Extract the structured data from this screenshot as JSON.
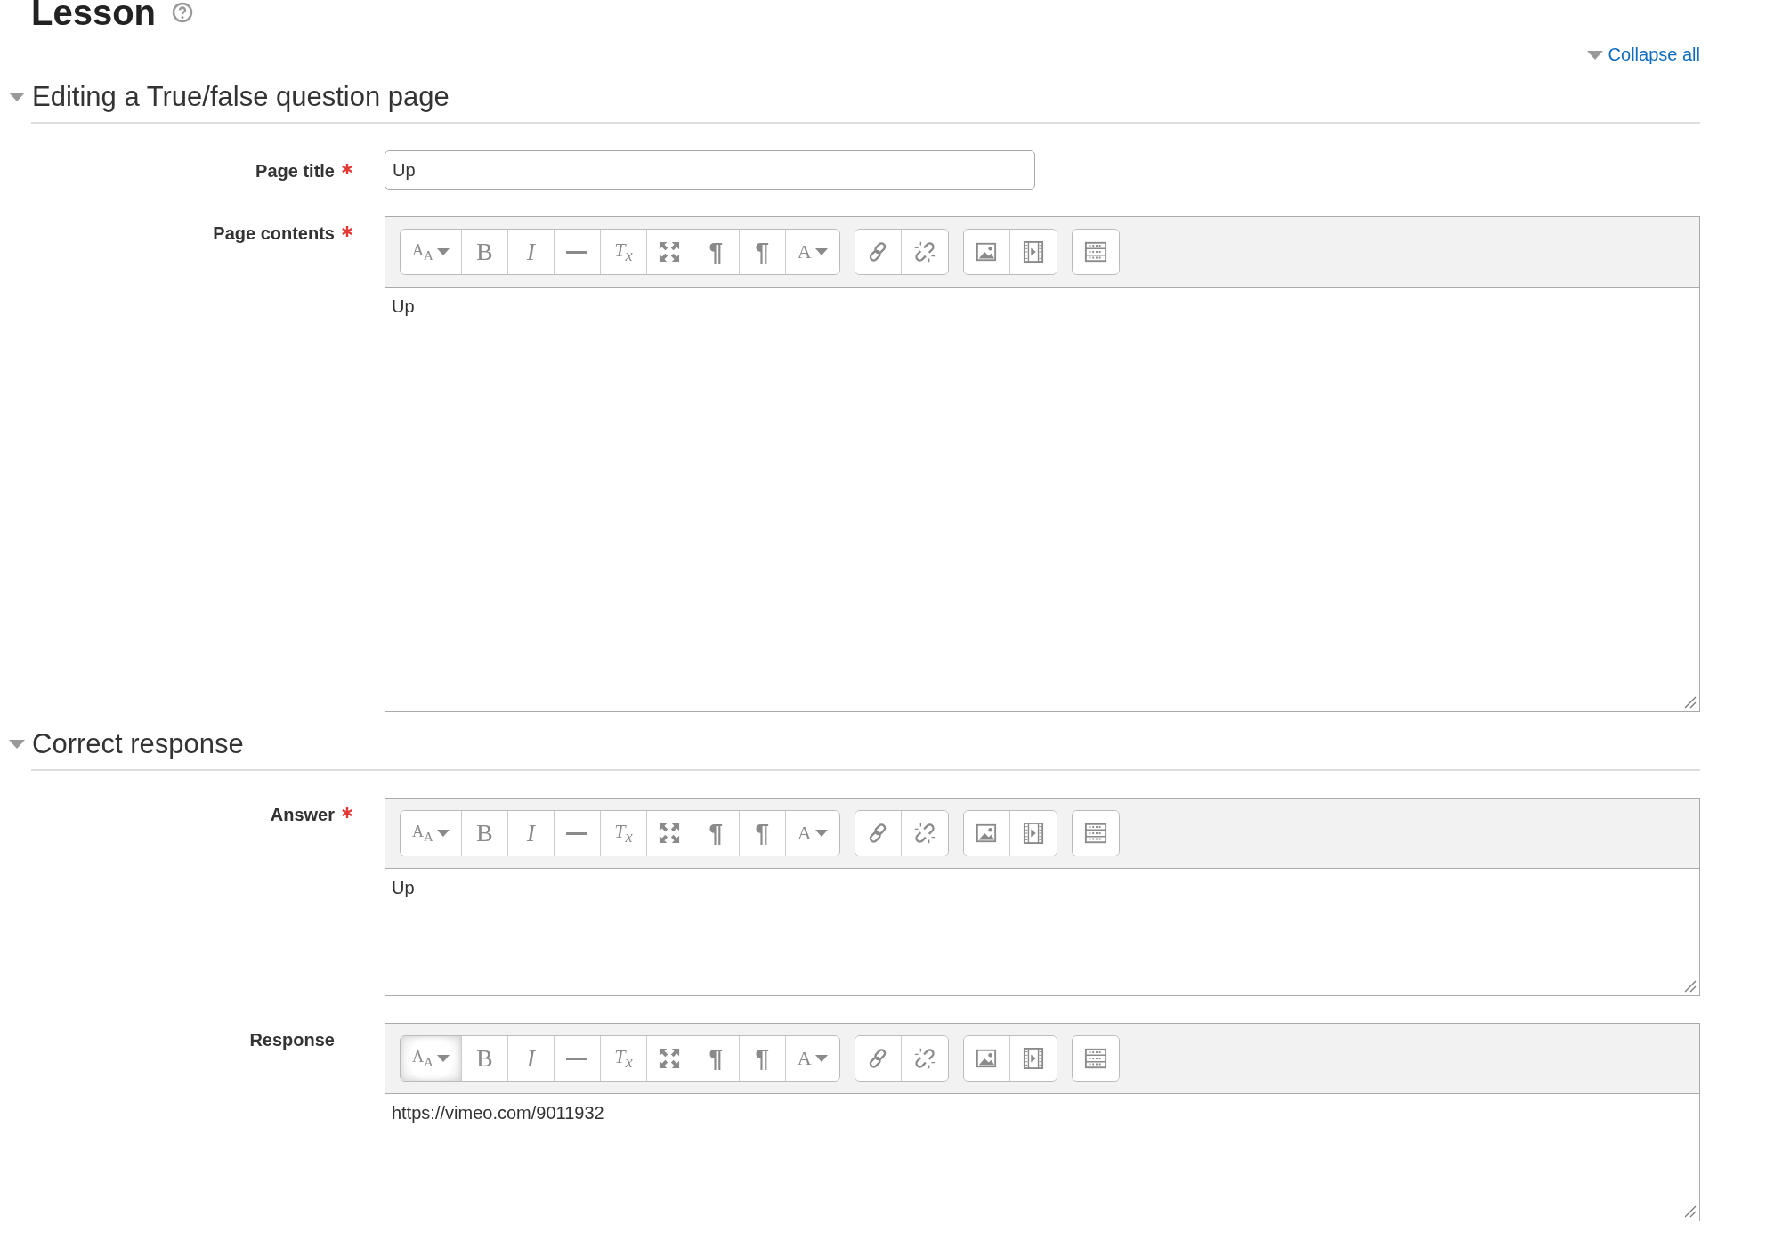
{
  "page_heading": "Lesson",
  "collapse_all": "Collapse all",
  "sections": [
    {
      "title": "Editing a True/false question page",
      "expanded": true,
      "fields": [
        {
          "kind": "text",
          "label": "Page title",
          "required": true,
          "value": "Up"
        },
        {
          "kind": "tall_editor",
          "label": "Page contents",
          "required": true,
          "value": "Up",
          "toolbar": [
            [
              {
                "kind": "style",
                "glyph": "A$_{A}$",
                "focused": false
              },
              {
                "kind": "bold",
                "glyph": "B",
                "focused": false
              },
              {
                "kind": "italic",
                "glyph": "I",
                "focused": false
              },
              {
                "kind": "rule",
                "focused": false
              },
              {
                "kind": "clear",
                "glyph": "T$_{x}$",
                "focused": false
              },
              {
                "kind": "fullscreen",
                "focused": false
              },
              {
                "kind": "ltr",
                "glyph": "¶",
                "focused": false
              },
              {
                "kind": "rtl",
                "glyph": "¶",
                "focused": false
              },
              {
                "kind": "color",
                "glyph": "A",
                "focused": false
              }
            ],
            [
              {
                "kind": "link",
                "focused": false
              },
              {
                "kind": "unlink",
                "focused": false
              }
            ],
            [
              {
                "kind": "image",
                "focused": false
              },
              {
                "kind": "media",
                "focused": false
              }
            ],
            [
              {
                "kind": "toggle",
                "focused": false
              }
            ]
          ]
        }
      ]
    },
    {
      "title": "Correct response",
      "expanded": true,
      "fields": [
        {
          "kind": "editor",
          "label": "Answer",
          "required": true,
          "value": "Up",
          "toolbar": [
            [
              {
                "kind": "style",
                "glyph": "A$_{A}$",
                "focused": false
              },
              {
                "kind": "bold",
                "glyph": "B",
                "focused": false
              },
              {
                "kind": "italic",
                "glyph": "I",
                "focused": false
              },
              {
                "kind": "rule",
                "focused": false
              },
              {
                "kind": "clear",
                "glyph": "T$_{x}$",
                "focused": false
              },
              {
                "kind": "fullscreen",
                "focused": false
              },
              {
                "kind": "ltr",
                "glyph": "¶",
                "focused": false
              },
              {
                "kind": "rtl",
                "glyph": "¶",
                "focused": false
              },
              {
                "kind": "color",
                "glyph": "A",
                "focused": false
              }
            ],
            [
              {
                "kind": "link",
                "focused": false
              },
              {
                "kind": "unlink",
                "focused": false
              }
            ],
            [
              {
                "kind": "image",
                "focused": false
              },
              {
                "kind": "media",
                "focused": false
              }
            ],
            [
              {
                "kind": "toggle",
                "focused": false
              }
            ]
          ]
        },
        {
          "kind": "editor",
          "label": "Response",
          "required": false,
          "value": "https://vimeo.com/9011932",
          "toolbar": [
            [
              {
                "kind": "style",
                "glyph": "A$_{A}$",
                "focused": true
              },
              {
                "kind": "bold",
                "glyph": "B",
                "focused": false
              },
              {
                "kind": "italic",
                "glyph": "I",
                "focused": false
              },
              {
                "kind": "rule",
                "focused": false
              },
              {
                "kind": "clear",
                "glyph": "T$_{x}$",
                "focused": false
              },
              {
                "kind": "fullscreen",
                "focused": false
              },
              {
                "kind": "ltr",
                "glyph": "¶",
                "focused": false
              },
              {
                "kind": "rtl",
                "glyph": "¶",
                "focused": false
              },
              {
                "kind": "color",
                "glyph": "A",
                "focused": false
              }
            ],
            [
              {
                "kind": "link",
                "focused": false
              },
              {
                "kind": "unlink",
                "focused": false
              }
            ],
            [
              {
                "kind": "image",
                "focused": false
              },
              {
                "kind": "media",
                "focused": false
              }
            ],
            [
              {
                "kind": "toggle",
                "focused": false
              }
            ]
          ]
        }
      ]
    }
  ]
}
